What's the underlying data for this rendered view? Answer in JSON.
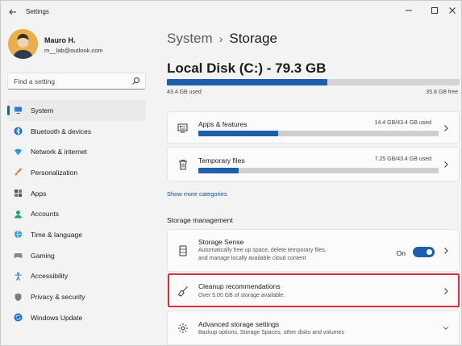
{
  "window": {
    "title": "Settings",
    "icons": {
      "back": "back-arrow-icon",
      "minimize": "minimize-icon",
      "maximize": "maximize-icon",
      "close": "close-icon"
    }
  },
  "profile": {
    "name": "Mauro H.",
    "email": "m__lab@outlook.com"
  },
  "search": {
    "placeholder": "Find a setting",
    "icon": "search-icon"
  },
  "sidebar": {
    "items": [
      {
        "label": "System",
        "icon": "system-icon",
        "selected": true
      },
      {
        "label": "Bluetooth & devices",
        "icon": "bluetooth-icon",
        "selected": false
      },
      {
        "label": "Network & internet",
        "icon": "network-icon",
        "selected": false
      },
      {
        "label": "Personalization",
        "icon": "brush-icon",
        "selected": false
      },
      {
        "label": "Apps",
        "icon": "apps-icon",
        "selected": false
      },
      {
        "label": "Accounts",
        "icon": "accounts-icon",
        "selected": false
      },
      {
        "label": "Time & language",
        "icon": "globe-icon",
        "selected": false
      },
      {
        "label": "Gaming",
        "icon": "gamepad-icon",
        "selected": false
      },
      {
        "label": "Accessibility",
        "icon": "accessibility-icon",
        "selected": false
      },
      {
        "label": "Privacy & security",
        "icon": "shield-icon",
        "selected": false
      },
      {
        "label": "Windows Update",
        "icon": "update-icon",
        "selected": false
      }
    ]
  },
  "breadcrumb": {
    "parent": "System",
    "separator": "›",
    "current": "Storage"
  },
  "disk": {
    "title": "Local Disk (C:) - 79.3 GB",
    "used": "43.4 GB used",
    "free": "35.8 GB free",
    "used_fraction": 0.547
  },
  "categories": [
    {
      "title": "Apps & features",
      "size": "14.4 GB/43.4 GB used",
      "fraction": 0.332,
      "icon": "apps-features-icon"
    },
    {
      "title": "Temporary files",
      "size": "7.25 GB/43.4 GB used",
      "fraction": 0.167,
      "icon": "trash-icon"
    }
  ],
  "show_more": "Show more categories",
  "storage_management": {
    "heading": "Storage management",
    "storage_sense": {
      "title": "Storage Sense",
      "desc_line1": "Automatically free up space, delete temporary files,",
      "desc_line2": "and manage locally available cloud content",
      "toggle_label": "On",
      "toggle_on": true,
      "icon": "drive-icon"
    },
    "cleanup": {
      "title": "Cleanup recommendations",
      "desc": "Over 5.00 GB of storage available.",
      "icon": "broom-icon"
    },
    "advanced": {
      "title": "Advanced storage settings",
      "desc": "Backup options, Storage Spaces, other disks and volumes",
      "icon": "gear-icon"
    }
  },
  "colors": {
    "accent": "#1d5fad",
    "highlight": "#d6303a",
    "background": "#f3f3f3",
    "card": "#fbfbfb"
  }
}
